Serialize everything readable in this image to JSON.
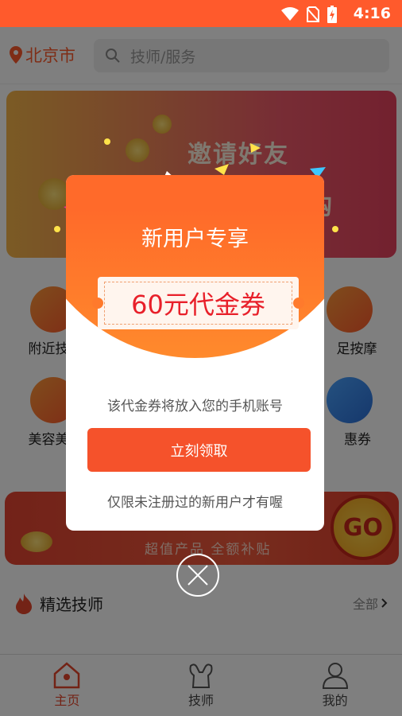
{
  "status_bar": {
    "time": "4:16"
  },
  "header": {
    "city": "北京市",
    "search_placeholder": "技师/服务"
  },
  "banner": {
    "line1": "邀请好友",
    "line2": "购"
  },
  "categories": [
    {
      "label": "附近技"
    },
    {
      "label": "足按摩"
    },
    {
      "label": "美容美"
    },
    {
      "label": "惠券"
    }
  ],
  "promo": {
    "text": "超值产品  全额补贴",
    "go": "GO"
  },
  "section": {
    "title": "精选技师",
    "more": "全部"
  },
  "bottom_nav": [
    {
      "label": "主页",
      "active": true
    },
    {
      "label": "技师",
      "active": false
    },
    {
      "label": "我的",
      "active": false
    }
  ],
  "modal": {
    "title": "新用户专享",
    "voucher": "60元代金券",
    "note": "该代金券将放入您的手机账号",
    "button": "立刻领取",
    "hint": "仅限未注册过的新用户才有喔"
  },
  "colors": {
    "accent": "#ff5a2c",
    "button": "#f5522b",
    "voucher_text": "#e8202a"
  }
}
